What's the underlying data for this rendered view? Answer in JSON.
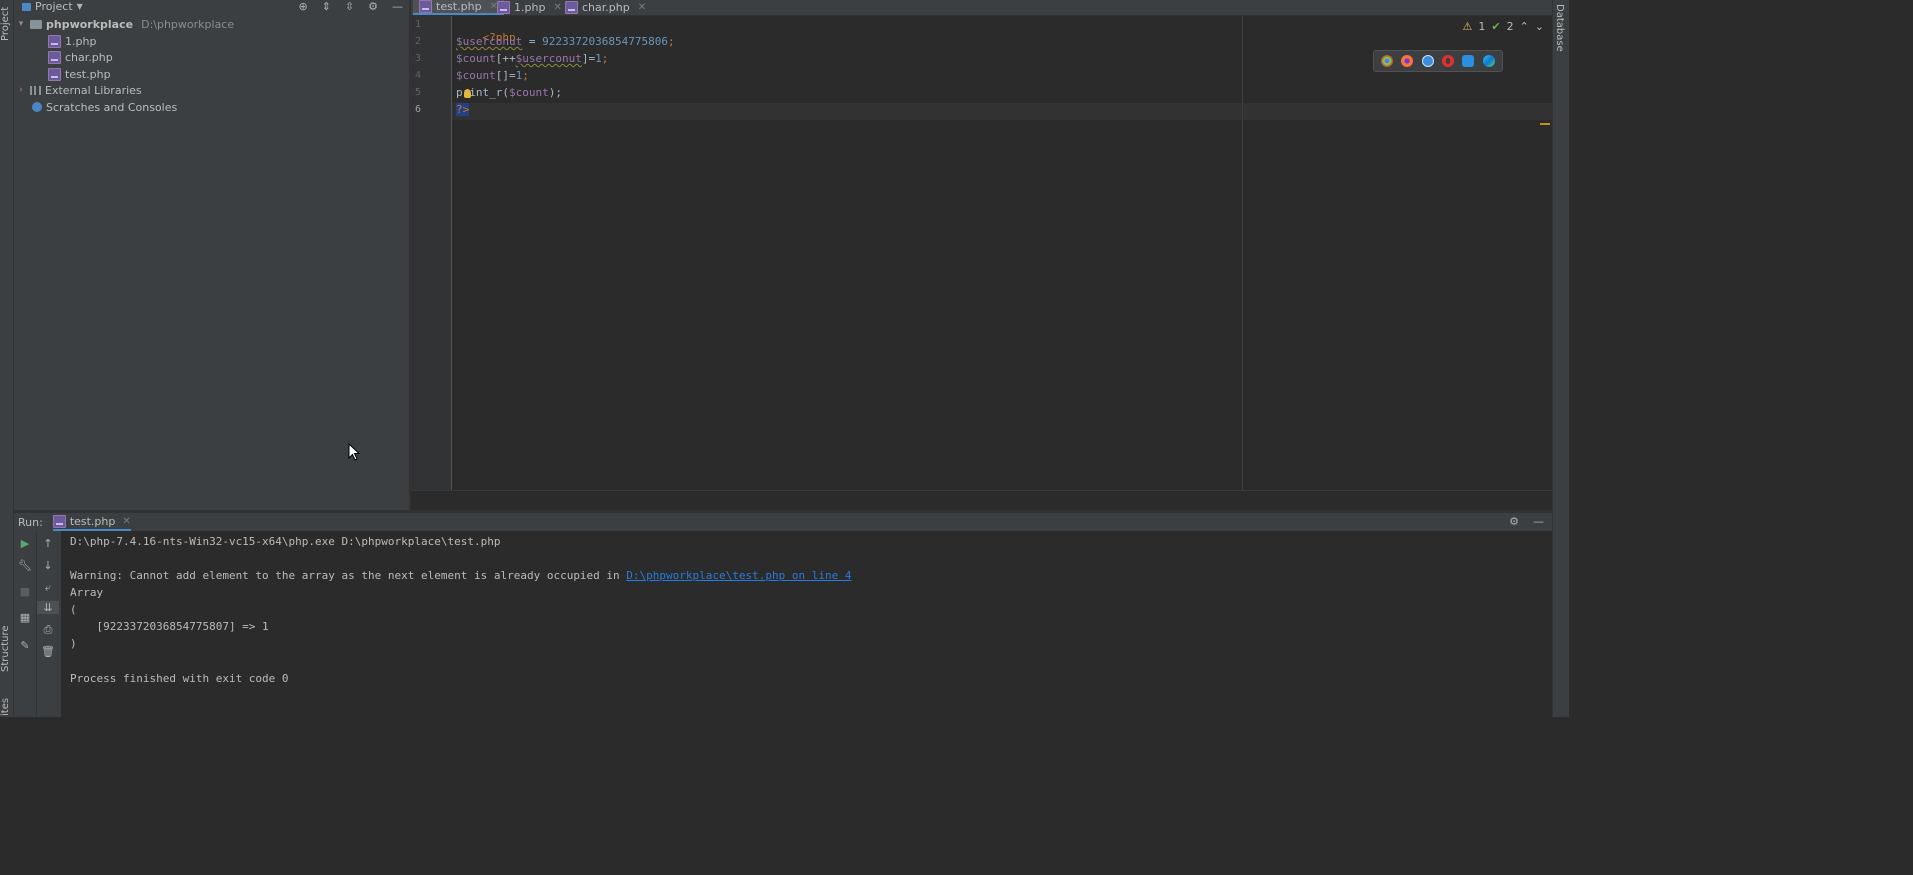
{
  "left_strip": {
    "project_label": "Project",
    "structure_label": "Structure",
    "favorites_label": "ites"
  },
  "right_strip": {
    "database_label": "Database"
  },
  "project": {
    "title": "Project",
    "tree": [
      {
        "name": "phpworkplace",
        "path": "D:\\phpworkplace"
      },
      {
        "name": "1.php"
      },
      {
        "name": "char.php"
      },
      {
        "name": "test.php"
      },
      {
        "name": "External Libraries"
      },
      {
        "name": "Scratches and Consoles"
      }
    ]
  },
  "tabs": [
    {
      "label": "test.php"
    },
    {
      "label": "1.php"
    },
    {
      "label": "char.php"
    }
  ],
  "editor": {
    "line_numbers": [
      "1",
      "2",
      "3",
      "4",
      "5",
      "6"
    ],
    "inspections": {
      "warnings": "1",
      "ok": "2"
    },
    "code": {
      "l1": "<?php",
      "l2_var": "$userconut",
      "l2_eq": " = ",
      "l2_num": "9223372036854775806",
      "l2_end": ";",
      "l3_a": "$count",
      "l3_b": "[++",
      "l3_c": "$userconut",
      "l3_d": "]=",
      "l3_e": "1",
      "l3_f": ";",
      "l4_a": "$count",
      "l4_b": "[]=",
      "l4_c": "1",
      "l4_d": ";",
      "l5_a": "print_r(",
      "l5_b": "$count",
      "l5_c": ");",
      "l6": "?>"
    },
    "browsers": [
      "chrome-icon",
      "firefox-icon",
      "safari-icon",
      "opera-icon",
      "ie-icon",
      "edge-icon"
    ]
  },
  "run": {
    "label": "Run:",
    "tab": "test.php",
    "console": {
      "cmd": "D:\\php-7.4.16-nts-Win32-vc15-x64\\php.exe D:\\phpworkplace\\test.php",
      "warning_text": "Warning: Cannot add element to the array as the next element is already occupied in ",
      "warning_link": "D:\\phpworkplace\\test.php on line 4",
      "array": "Array",
      "open_paren": "(",
      "entry": "    [9223372036854775807] => 1",
      "close_paren": ")",
      "finished": "Process finished with exit code 0"
    }
  },
  "colors": {
    "accent": "#4a88c7",
    "keyword": "#cc7832",
    "variable": "#9876aa",
    "number": "#6897bb",
    "link": "#287bde"
  }
}
